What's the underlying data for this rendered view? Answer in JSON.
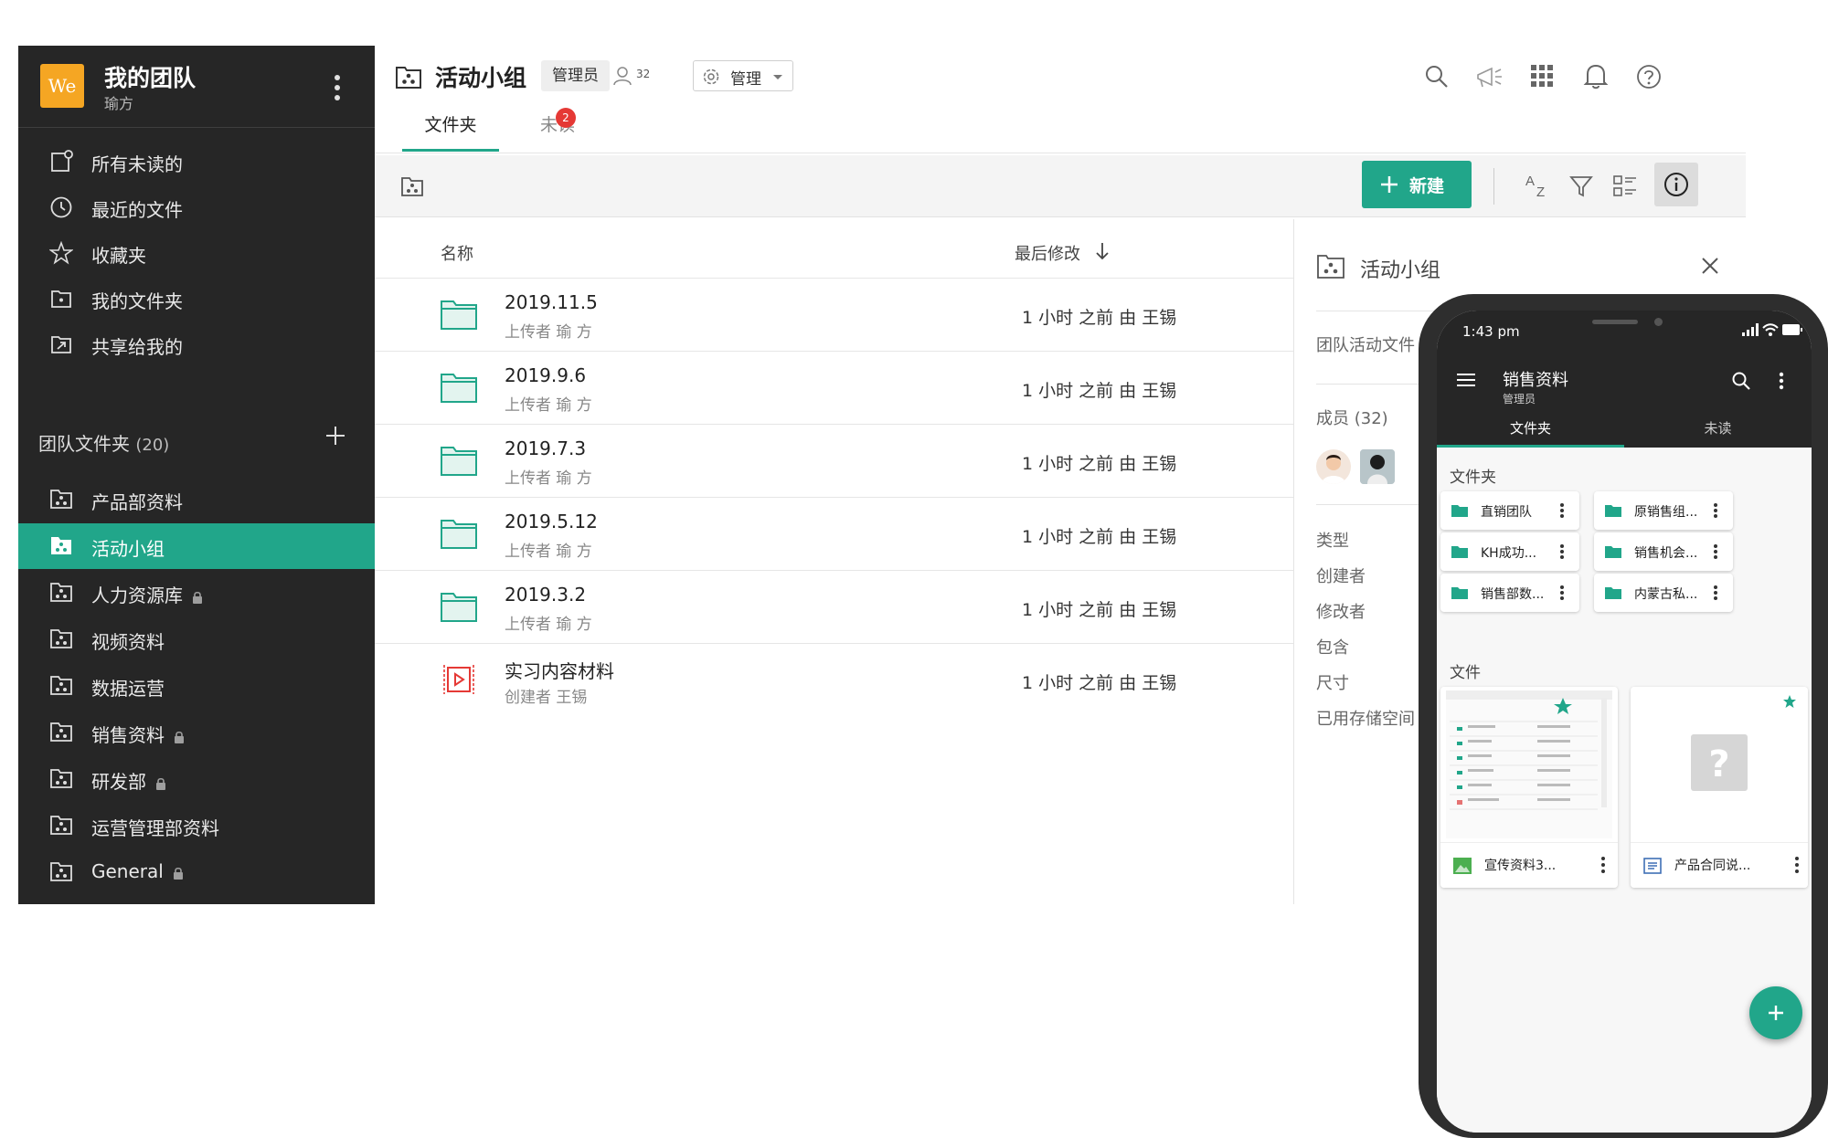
{
  "sidebar": {
    "logo_text": "We",
    "team_name": "我的团队",
    "user_name": "瑜方",
    "nav": [
      {
        "label": "所有未读的",
        "icon": "unread-icon"
      },
      {
        "label": "最近的文件",
        "icon": "clock-icon"
      },
      {
        "label": "收藏夹",
        "icon": "star-icon"
      },
      {
        "label": "我的文件夹",
        "icon": "my-folder-icon"
      },
      {
        "label": "共享给我的",
        "icon": "shared-icon"
      }
    ],
    "section_label": "团队文件夹",
    "section_count": "(20)",
    "team_folders": [
      {
        "label": "产品部资料",
        "locked": false
      },
      {
        "label": "活动小组",
        "locked": false,
        "active": true
      },
      {
        "label": "人力资源库",
        "locked": true
      },
      {
        "label": "视频资料",
        "locked": false
      },
      {
        "label": "数据运营",
        "locked": false
      },
      {
        "label": "销售资料",
        "locked": true
      },
      {
        "label": "研发部",
        "locked": true
      },
      {
        "label": "运营管理部资料",
        "locked": false
      },
      {
        "label": "General",
        "locked": true
      }
    ]
  },
  "header": {
    "title": "活动小组",
    "role_badge": "管理员",
    "member_count": "32",
    "manage_label": "管理",
    "tabs": {
      "folder": "文件夹",
      "unread": "未读"
    },
    "unread_badge": "2"
  },
  "toolbar": {
    "new_label": "新建"
  },
  "list": {
    "col_name": "名称",
    "col_modified": "最后修改",
    "rows": [
      {
        "name": "2019.11.5",
        "sub": "上传者 瑜 方",
        "modified": "1 小时 之前 由 王锡",
        "type": "folder"
      },
      {
        "name": "2019.9.6",
        "sub": "上传者 瑜 方",
        "modified": "1 小时 之前 由 王锡",
        "type": "folder"
      },
      {
        "name": "2019.7.3",
        "sub": "上传者 瑜 方",
        "modified": "1 小时 之前 由 王锡",
        "type": "folder"
      },
      {
        "name": "2019.5.12",
        "sub": "上传者 瑜 方",
        "modified": "1 小时 之前 由 王锡",
        "type": "folder"
      },
      {
        "name": "2019.3.2",
        "sub": "上传者 瑜 方",
        "modified": "1 小时 之前 由 王锡",
        "type": "folder"
      },
      {
        "name": "实习内容材料",
        "sub": "创建者 王锡",
        "modified": "1 小时 之前 由 王锡",
        "type": "video"
      }
    ]
  },
  "detail": {
    "title": "活动小组",
    "description": "团队活动文件",
    "members_label": "成员 (32)",
    "props": [
      "类型",
      "创建者",
      "修改者",
      "包含",
      "尺寸",
      "已用存储空间"
    ]
  },
  "phone": {
    "time": "1:43 pm",
    "title": "销售资料",
    "subtitle": "管理员",
    "tabs": {
      "folder": "文件夹",
      "unread": "未读"
    },
    "folders_label": "文件夹",
    "folders": [
      "直销团队",
      "原销售组...",
      "KH成功...",
      "销售机会...",
      "销售部数...",
      "内蒙古私..."
    ],
    "files_label": "文件",
    "files": [
      "宣传资料3...",
      "产品合同说..."
    ]
  },
  "colors": {
    "accent": "#21a68a",
    "sidebar_bg": "#262626",
    "badge_red": "#e53935",
    "logo_bg": "#f5a623"
  }
}
